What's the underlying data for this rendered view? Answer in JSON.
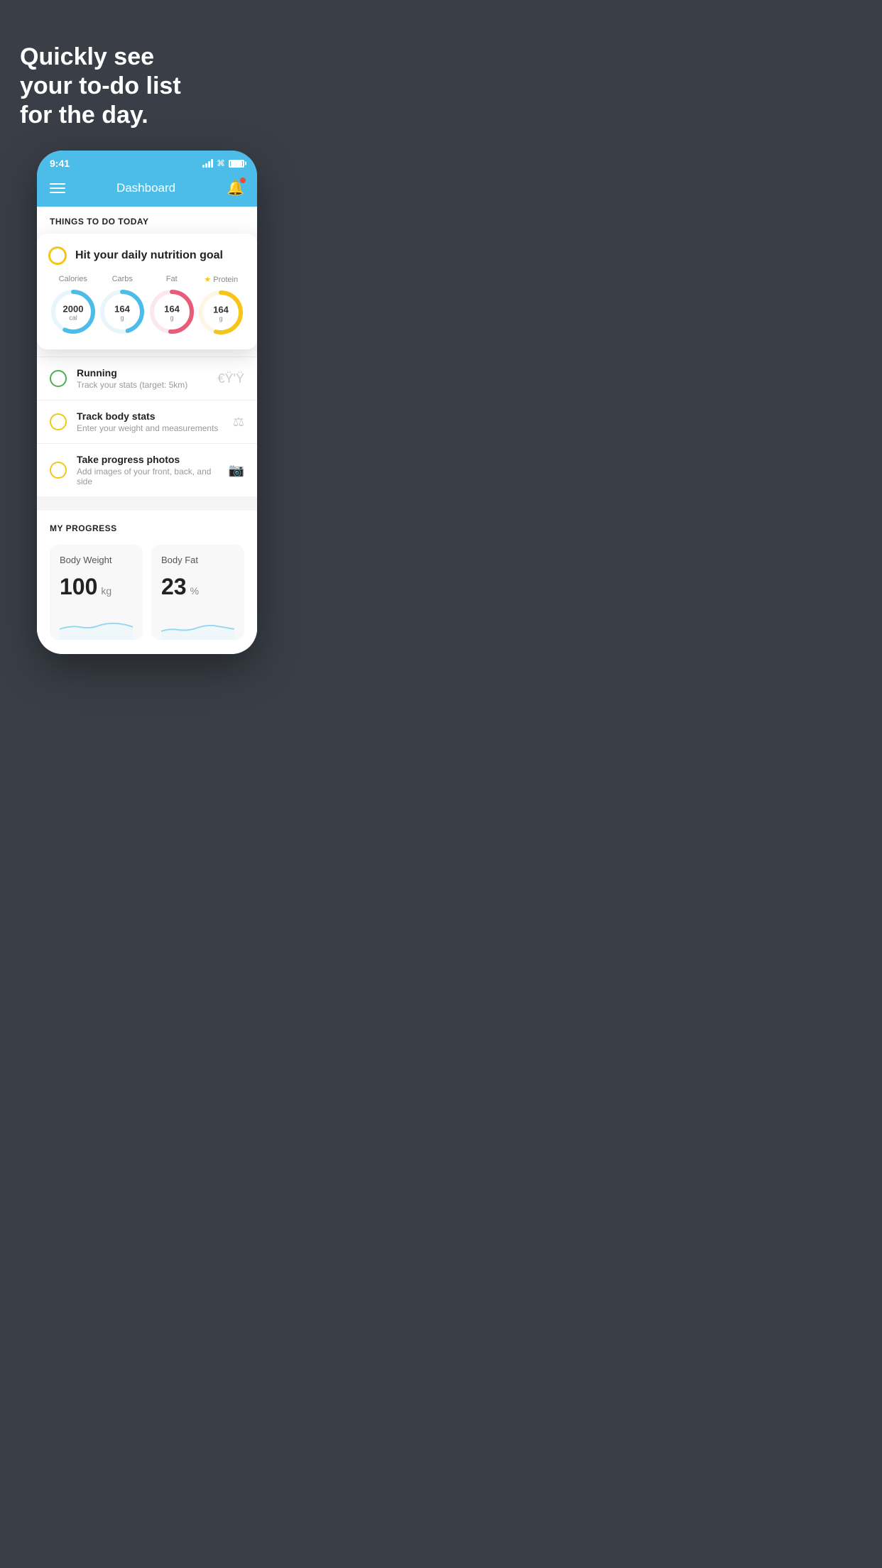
{
  "hero": {
    "title_line1": "Quickly see",
    "title_line2": "your to-do list",
    "title_line3": "for the day."
  },
  "status_bar": {
    "time": "9:41"
  },
  "header": {
    "title": "Dashboard"
  },
  "things_section": {
    "heading": "THINGS TO DO TODAY"
  },
  "nutrition_card": {
    "title": "Hit your daily nutrition goal",
    "calories_label": "Calories",
    "calories_value": "2000",
    "calories_unit": "cal",
    "carbs_label": "Carbs",
    "carbs_value": "164",
    "carbs_unit": "g",
    "fat_label": "Fat",
    "fat_value": "164",
    "fat_unit": "g",
    "protein_label": "Protein",
    "protein_value": "164",
    "protein_unit": "g"
  },
  "todo_items": [
    {
      "title": "Running",
      "subtitle": "Track your stats (target: 5km)",
      "status": "green"
    },
    {
      "title": "Track body stats",
      "subtitle": "Enter your weight and measurements",
      "status": "yellow"
    },
    {
      "title": "Take progress photos",
      "subtitle": "Add images of your front, back, and side",
      "status": "yellow"
    }
  ],
  "progress_section": {
    "heading": "MY PROGRESS",
    "weight_label": "Body Weight",
    "weight_value": "100",
    "weight_unit": "kg",
    "fat_label": "Body Fat",
    "fat_value": "23",
    "fat_unit": "%"
  }
}
